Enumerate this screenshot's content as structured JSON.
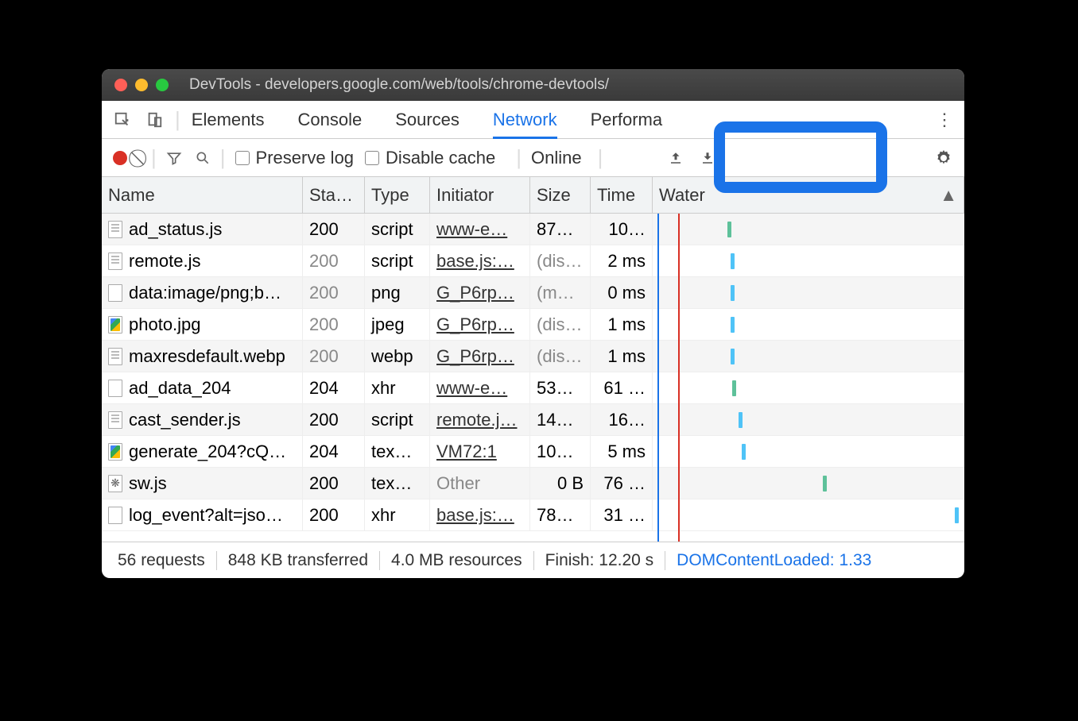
{
  "window": {
    "title": "DevTools - developers.google.com/web/tools/chrome-devtools/"
  },
  "tabs": [
    "Elements",
    "Console",
    "Sources",
    "Network",
    "Performa"
  ],
  "active_tab": "Network",
  "toolbar": {
    "preserve_log": "Preserve log",
    "disable_cache": "Disable cache",
    "throttling": "Online"
  },
  "columns": {
    "name": "Name",
    "status": "Sta…",
    "type": "Type",
    "initiator": "Initiator",
    "size": "Size",
    "time": "Time",
    "waterfall": "Water"
  },
  "rows": [
    {
      "name": "ad_status.js",
      "icon": "doc",
      "status": "200",
      "dim": false,
      "type": "script",
      "init": "www-e…",
      "ilink": true,
      "size": "87…",
      "time": "10…",
      "wx": 94,
      "wc": "#5ec19a"
    },
    {
      "name": "remote.js",
      "icon": "doc",
      "status": "200",
      "dim": true,
      "type": "script",
      "init": "base.js:…",
      "ilink": true,
      "size": "(dis…",
      "sdim": true,
      "time": "2 ms",
      "wx": 98,
      "wc": "#4fc3f7"
    },
    {
      "name": "data:image/png;b…",
      "icon": "plain",
      "status": "200",
      "dim": true,
      "type": "png",
      "init": "G_P6rp…",
      "ilink": true,
      "size": "(m…",
      "sdim": true,
      "time": "0 ms",
      "wx": 98,
      "wc": "#4fc3f7"
    },
    {
      "name": "photo.jpg",
      "icon": "img",
      "status": "200",
      "dim": true,
      "type": "jpeg",
      "init": "G_P6rp…",
      "ilink": true,
      "size": "(dis…",
      "sdim": true,
      "time": "1 ms",
      "wx": 98,
      "wc": "#4fc3f7"
    },
    {
      "name": "maxresdefault.webp",
      "icon": "doc",
      "status": "200",
      "dim": true,
      "type": "webp",
      "init": "G_P6rp…",
      "ilink": true,
      "size": "(dis…",
      "sdim": true,
      "time": "1 ms",
      "wx": 98,
      "wc": "#4fc3f7"
    },
    {
      "name": "ad_data_204",
      "icon": "plain",
      "status": "204",
      "dim": false,
      "type": "xhr",
      "init": "www-e…",
      "ilink": true,
      "size": "53…",
      "time": "61 …",
      "wx": 100,
      "wc": "#5ec19a"
    },
    {
      "name": "cast_sender.js",
      "icon": "doc",
      "status": "200",
      "dim": false,
      "type": "script",
      "init": "remote.j…",
      "ilink": true,
      "size": "14…",
      "time": "16…",
      "wx": 108,
      "wc": "#4fc3f7"
    },
    {
      "name": "generate_204?cQ…",
      "icon": "img",
      "status": "204",
      "dim": false,
      "type": "tex…",
      "init": "VM72:1",
      "ilink": true,
      "size": "10…",
      "time": "5 ms",
      "wx": 112,
      "wc": "#4fc3f7"
    },
    {
      "name": "sw.js",
      "icon": "gear-i",
      "status": "200",
      "dim": false,
      "type": "tex…",
      "init": "Other",
      "ilink": false,
      "idim": true,
      "size": "0 B",
      "sright": true,
      "time": "76 …",
      "wx": 214,
      "wc": "#5ec19a"
    },
    {
      "name": "log_event?alt=jso…",
      "icon": "plain",
      "status": "200",
      "dim": false,
      "type": "xhr",
      "init": "base.js:…",
      "ilink": true,
      "size": "78…",
      "time": "31 …",
      "wx": 380,
      "wc": "#4fc3f7"
    }
  ],
  "summary": {
    "requests": "56 requests",
    "transferred": "848 KB transferred",
    "resources": "4.0 MB resources",
    "finish": "Finish: 12.20 s",
    "dcl": "DOMContentLoaded: 1.33"
  }
}
